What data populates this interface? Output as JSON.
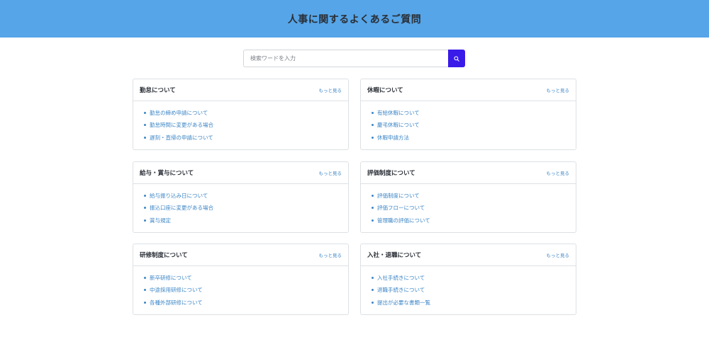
{
  "header": {
    "title": "人事に関するよくあるご質問"
  },
  "search": {
    "placeholder": "検索ワードを入力",
    "value": ""
  },
  "more_label": "もっと見る",
  "colors": {
    "header_bg": "#56a5e8",
    "search_button": "#3a1ae8",
    "link": "#3d86c6"
  },
  "categories": [
    {
      "title": "勤怠について",
      "more": "もっと見る",
      "items": [
        "勤怠の締め申請について",
        "勤怠時間に変更がある場合",
        "遅刻・直帰の申請について"
      ]
    },
    {
      "title": "休暇について",
      "more": "もっと見る",
      "items": [
        "有給休暇について",
        "慶弔休暇について",
        "休暇申請方法"
      ]
    },
    {
      "title": "給与・賞与について",
      "more": "もっと見る",
      "items": [
        "給与振り込み日について",
        "振込口座に変更がある場合",
        "賞与規定"
      ]
    },
    {
      "title": "評価制度について",
      "more": "もっと見る",
      "items": [
        "評価制度について",
        "評価フローについて",
        "管理職の評価について"
      ]
    },
    {
      "title": "研修制度について",
      "more": "もっと見る",
      "items": [
        "新卒研修について",
        "中途採用研修について",
        "各種外部研修について"
      ]
    },
    {
      "title": "入社・退職について",
      "more": "もっと見る",
      "items": [
        "入社手続きについて",
        "退職手続きについて",
        "提出が必要な書類一覧"
      ]
    }
  ]
}
